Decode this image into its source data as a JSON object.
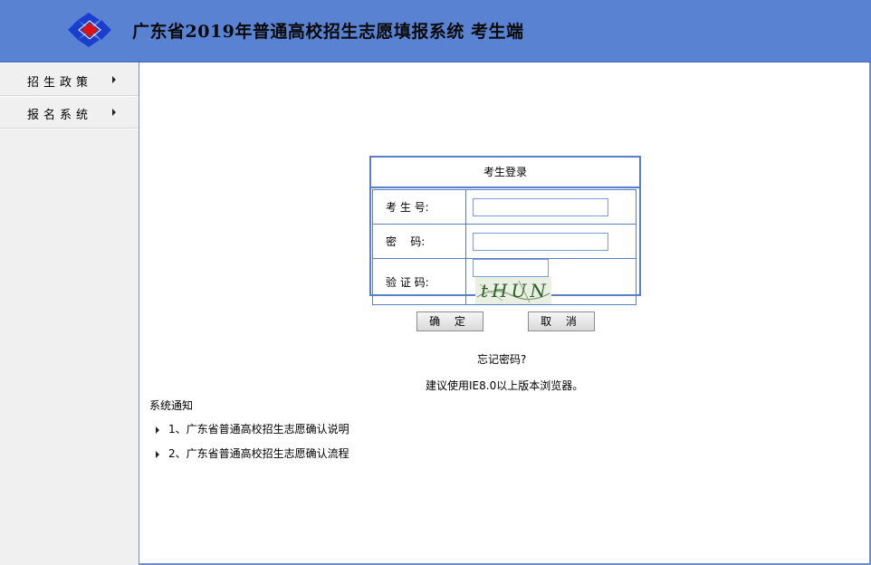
{
  "header": {
    "title": "广东省2019年普通高校招生志愿填报系统 考生端",
    "logo_icon": "diamond-logo-icon",
    "colors": {
      "bar": "#5a82d2",
      "logo_blue": "#1a3fd0",
      "logo_red": "#e01010"
    }
  },
  "sidebar": {
    "items": [
      {
        "label": "招生政策",
        "icon": "caret-right-icon"
      },
      {
        "label": "报名系统",
        "icon": "caret-right-icon"
      }
    ]
  },
  "login": {
    "title": "考生登录",
    "fields": {
      "exam_no_label": "考 生 号:",
      "exam_no_value": "",
      "password_label": "密    码:",
      "password_value": "",
      "captcha_label": "验 证 码:",
      "captcha_value": "",
      "captcha_text": "tHUN"
    },
    "confirm_label": "确 定",
    "cancel_label": "取 消",
    "forgot_password": "忘记密码?"
  },
  "browser_tip": "建议使用IE8.0以上版本浏览器。",
  "notices": {
    "title": "系统通知",
    "items": [
      {
        "text": "1、广东省普通高校招生志愿确认说明"
      },
      {
        "text": "2、广东省普通高校招生志愿确认流程"
      }
    ]
  }
}
